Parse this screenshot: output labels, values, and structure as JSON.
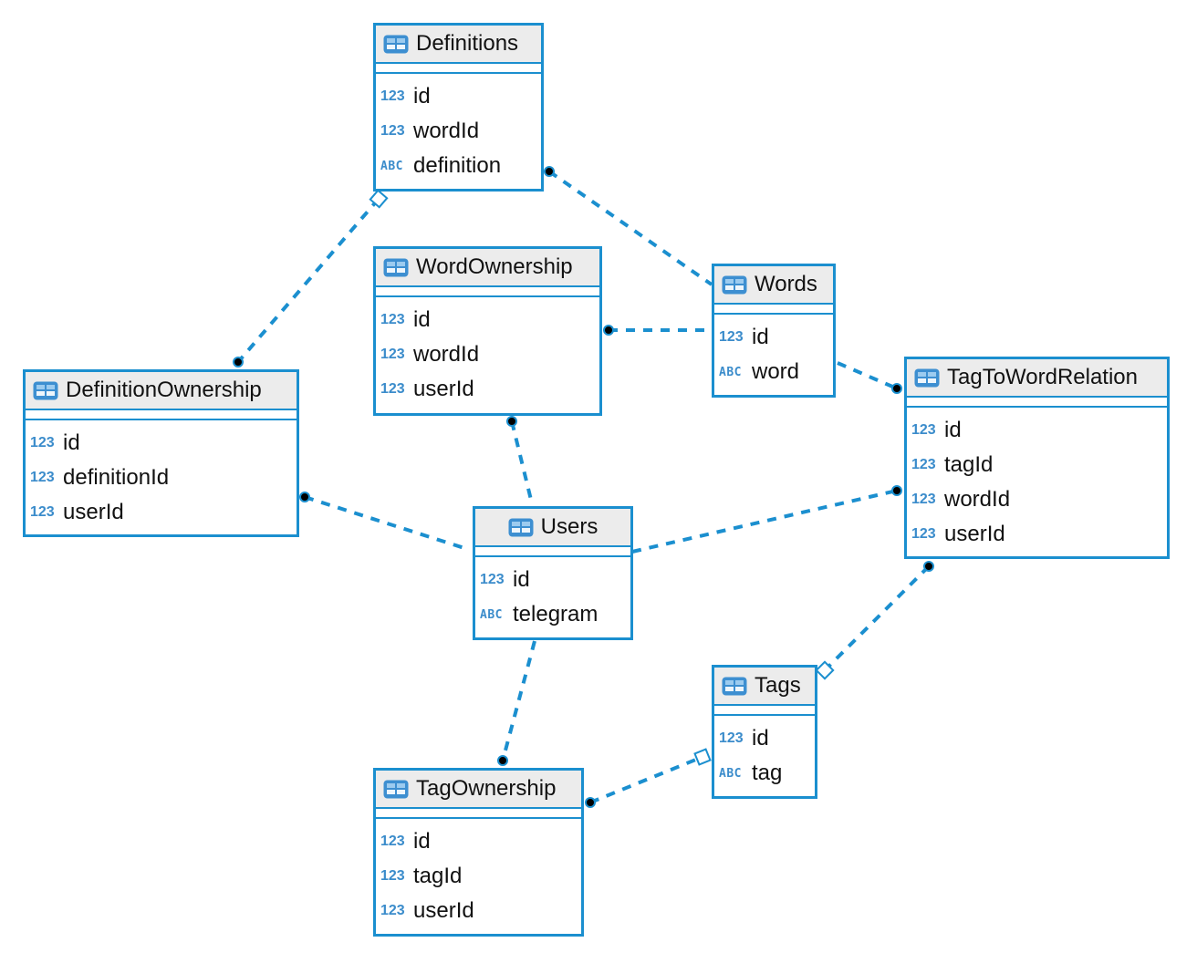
{
  "diagram": {
    "type": "er-diagram",
    "colors": {
      "accent": "#1b8fcf",
      "header_bg": "#ececec",
      "type_label": "#3b8ccb",
      "dot": "#000000"
    },
    "entities": [
      {
        "key": "definitions",
        "title": "Definitions",
        "icon": "table-icon",
        "attributes": [
          {
            "type": "123",
            "name": "id"
          },
          {
            "type": "123",
            "name": "wordId"
          },
          {
            "type": "ABC",
            "name": "definition"
          }
        ]
      },
      {
        "key": "wordownership",
        "title": "WordOwnership",
        "icon": "table-icon",
        "attributes": [
          {
            "type": "123",
            "name": "id"
          },
          {
            "type": "123",
            "name": "wordId"
          },
          {
            "type": "123",
            "name": "userId"
          }
        ]
      },
      {
        "key": "words",
        "title": "Words",
        "icon": "table-icon",
        "attributes": [
          {
            "type": "123",
            "name": "id"
          },
          {
            "type": "ABC",
            "name": "word"
          }
        ]
      },
      {
        "key": "definitionownership",
        "title": "DefinitionOwnership",
        "icon": "table-icon",
        "attributes": [
          {
            "type": "123",
            "name": "id"
          },
          {
            "type": "123",
            "name": "definitionId"
          },
          {
            "type": "123",
            "name": "userId"
          }
        ]
      },
      {
        "key": "users",
        "title": "Users",
        "icon": "table-icon",
        "attributes": [
          {
            "type": "123",
            "name": "id"
          },
          {
            "type": "ABC",
            "name": "telegram"
          }
        ]
      },
      {
        "key": "tagtowordrelation",
        "title": "TagToWordRelation",
        "icon": "table-icon",
        "attributes": [
          {
            "type": "123",
            "name": "id"
          },
          {
            "type": "123",
            "name": "tagId"
          },
          {
            "type": "123",
            "name": "wordId"
          },
          {
            "type": "123",
            "name": "userId"
          }
        ]
      },
      {
        "key": "tags",
        "title": "Tags",
        "icon": "table-icon",
        "attributes": [
          {
            "type": "123",
            "name": "id"
          },
          {
            "type": "ABC",
            "name": "tag"
          }
        ]
      },
      {
        "key": "tagownership",
        "title": "TagOwnership",
        "icon": "table-icon",
        "attributes": [
          {
            "type": "123",
            "name": "id"
          },
          {
            "type": "123",
            "name": "tagId"
          },
          {
            "type": "123",
            "name": "userId"
          }
        ]
      }
    ],
    "relationships": [
      {
        "from": "definitions",
        "to": "words",
        "from_end": "dot",
        "to_end": "none"
      },
      {
        "from": "definitions",
        "to": "definitionownership",
        "from_end": "open-square",
        "to_end": "dot"
      },
      {
        "from": "wordownership",
        "to": "words",
        "from_end": "dot",
        "to_end": "none"
      },
      {
        "from": "words",
        "to": "tagtowordrelation",
        "from_end": "none",
        "to_end": "dot"
      },
      {
        "from": "wordownership",
        "to": "users",
        "from_end": "dot",
        "to_end": "none"
      },
      {
        "from": "definitionownership",
        "to": "users",
        "from_end": "dot",
        "to_end": "none"
      },
      {
        "from": "users",
        "to": "tagtowordrelation",
        "from_end": "none",
        "to_end": "dot"
      },
      {
        "from": "users",
        "to": "tagownership",
        "from_end": "none",
        "to_end": "dot"
      },
      {
        "from": "tagownership",
        "to": "tags",
        "from_end": "dot",
        "to_end": "open-square"
      },
      {
        "from": "tagtowordrelation",
        "to": "tags",
        "from_end": "dot",
        "to_end": "open-square"
      }
    ]
  }
}
